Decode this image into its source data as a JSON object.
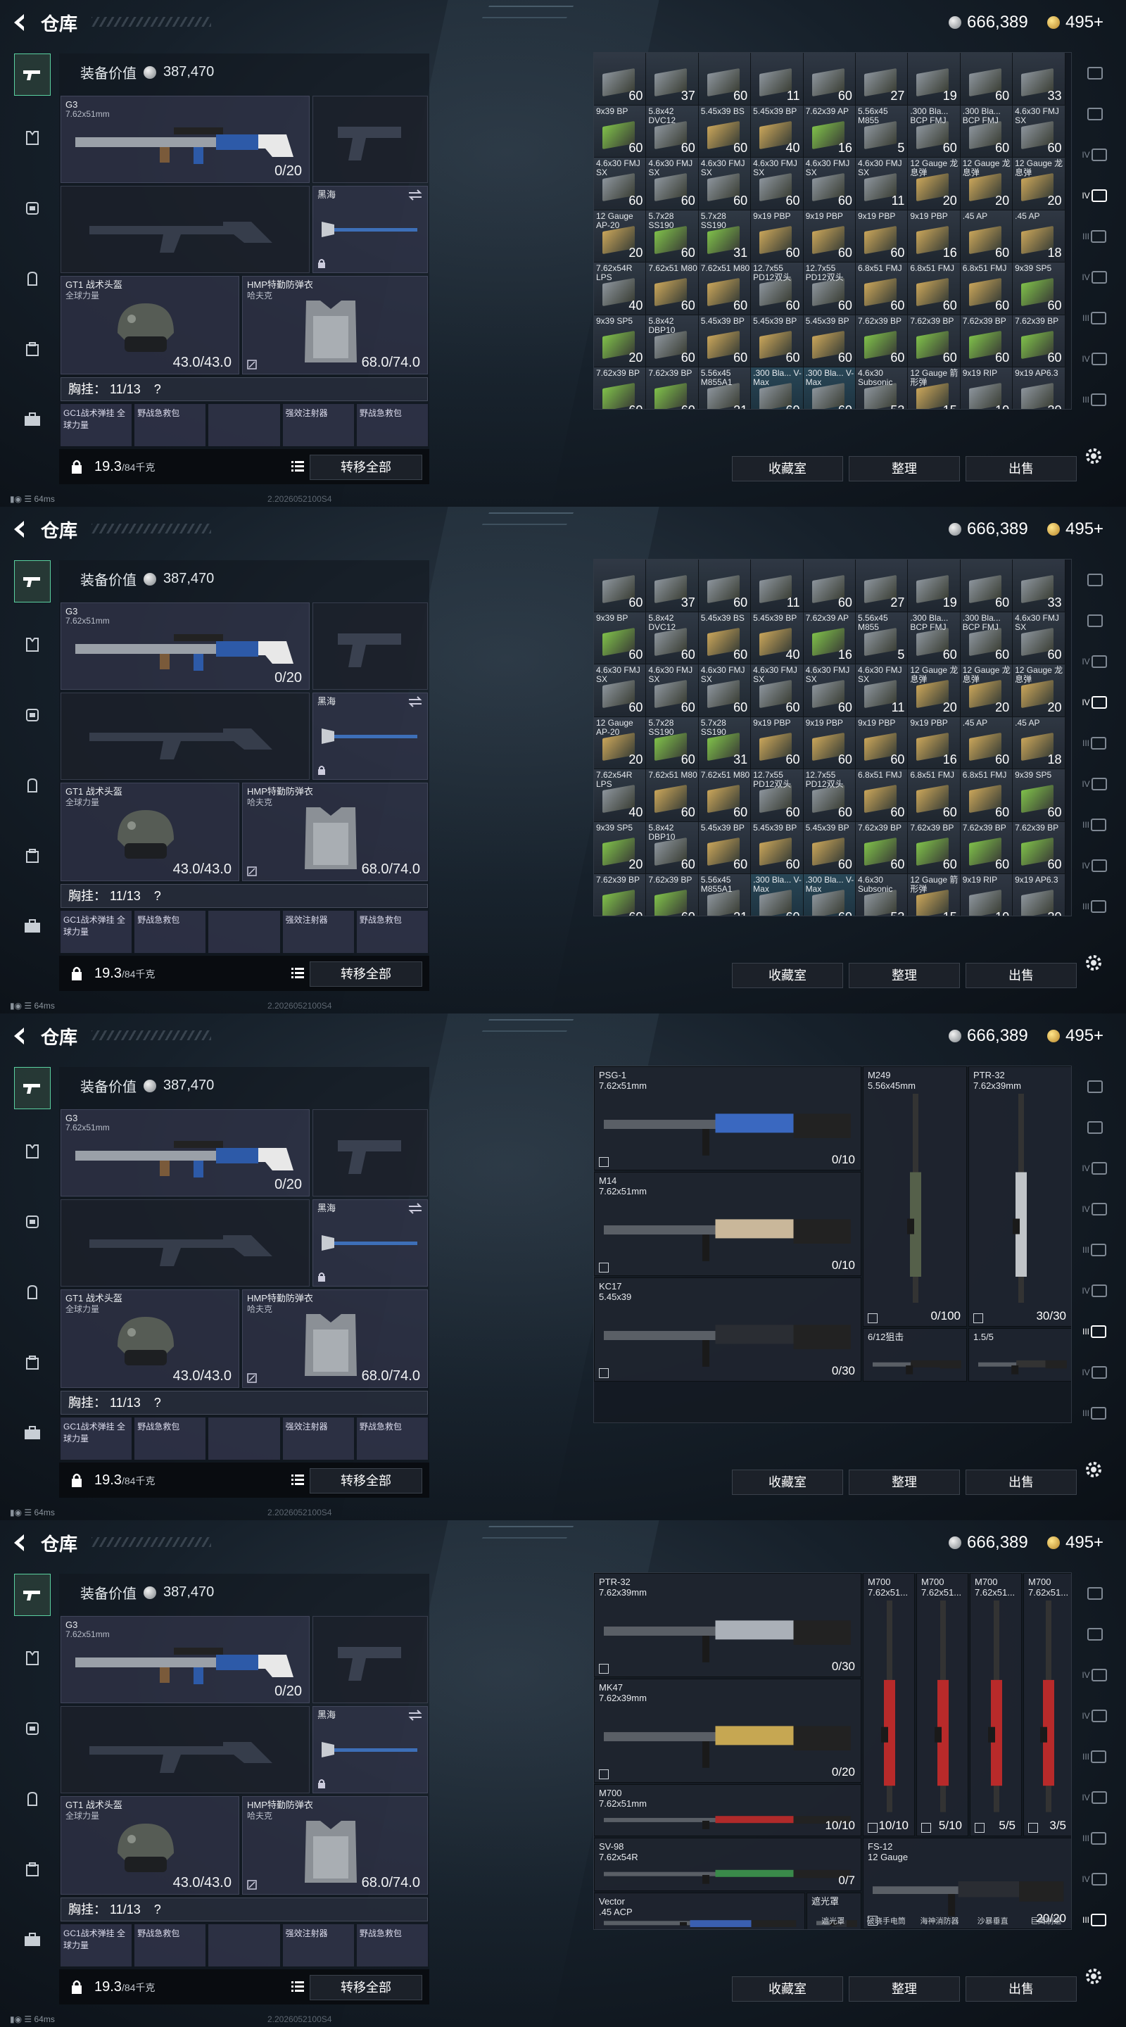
{
  "app": {
    "title": "仓库",
    "silver": "666,389",
    "gold": "495+",
    "ping": "64ms",
    "build": "2.2026052100S4"
  },
  "loadout": {
    "equip_value_label": "装备价值",
    "equip_value": "387,470",
    "primary": {
      "name": "G3",
      "caliber": "7.62x51mm",
      "ammo": "0/20"
    },
    "melee": {
      "name": "黑海"
    },
    "helmet": {
      "name": "GT1 战术头盔",
      "sub": "全球力量",
      "durability": "43.0/43.0"
    },
    "armor": {
      "name": "HMP特勤防弹衣",
      "sub": "哈夫克",
      "durability": "68.0/74.0"
    },
    "chest_label": "胸挂：",
    "chest_value": "11/13",
    "chest_help": "?",
    "pockets": [
      "GC1战术弹挂 全球力量",
      "野战急救包",
      "",
      "强效注射器",
      "野战急救包"
    ],
    "weight": "19.3",
    "weight_max": "/84千克",
    "transfer_label": "转移全部"
  },
  "actions": {
    "vault": "收藏室",
    "sort": "整理",
    "sell": "出售"
  },
  "rail": [
    "",
    "",
    "IV",
    "IV",
    "III",
    "IV",
    "III",
    "IV",
    "III"
  ],
  "ammo_rows": [
    [
      [
        "",
        "60"
      ],
      [
        "",
        "37"
      ],
      [
        "",
        "60"
      ],
      [
        "",
        "11"
      ],
      [
        "",
        "60"
      ],
      [
        "",
        "27"
      ],
      [
        "",
        "19"
      ],
      [
        "",
        "60"
      ],
      [
        "",
        "33"
      ]
    ],
    [
      [
        "9x39 BP",
        "60"
      ],
      [
        "5.8x42 DVC12",
        "60"
      ],
      [
        "5.45x39 BS",
        "60"
      ],
      [
        "5.45x39 BP",
        "40"
      ],
      [
        "7.62x39 AP",
        "16"
      ],
      [
        "5.56x45 M855",
        "5"
      ],
      [
        ".300 Bla... BCP FMJ",
        "60"
      ],
      [
        ".300 Bla... BCP FMJ",
        "60"
      ],
      [
        "4.6x30 FMJ SX",
        "60"
      ]
    ],
    [
      [
        "4.6x30 FMJ SX",
        "60"
      ],
      [
        "4.6x30 FMJ SX",
        "60"
      ],
      [
        "4.6x30 FMJ SX",
        "60"
      ],
      [
        "4.6x30 FMJ SX",
        "60"
      ],
      [
        "4.6x30 FMJ SX",
        "60"
      ],
      [
        "4.6x30 FMJ SX",
        "11"
      ],
      [
        "12 Gauge 龙息弹",
        "20"
      ],
      [
        "12 Gauge 龙息弹",
        "20"
      ],
      [
        "12 Gauge 龙息弹",
        "20"
      ]
    ],
    [
      [
        "12 Gauge AP-20",
        "20"
      ],
      [
        "5.7x28 SS190",
        "60"
      ],
      [
        "5.7x28 SS190",
        "31"
      ],
      [
        "9x19 PBP",
        "60"
      ],
      [
        "9x19 PBP",
        "60"
      ],
      [
        "9x19 PBP",
        "60"
      ],
      [
        "9x19 PBP",
        "16"
      ],
      [
        ".45 AP",
        "60"
      ],
      [
        ".45 AP",
        "18"
      ]
    ],
    [
      [
        "7.62x54R LPS",
        "40"
      ],
      [
        "7.62x51 M80",
        "60"
      ],
      [
        "7.62x51 M80",
        "60"
      ],
      [
        "12.7x55 PD12双头",
        "60"
      ],
      [
        "12.7x55 PD12双头",
        "60"
      ],
      [
        "6.8x51 FMJ",
        "60"
      ],
      [
        "6.8x51 FMJ",
        "60"
      ],
      [
        "6.8x51 FMJ",
        "60"
      ],
      [
        "9x39 SP5",
        "60"
      ]
    ],
    [
      [
        "9x39 SP5",
        "20"
      ],
      [
        "5.8x42 DBP10",
        "60"
      ],
      [
        "5.45x39 BP",
        "60"
      ],
      [
        "5.45x39 BP",
        "60"
      ],
      [
        "5.45x39 BP",
        "60"
      ],
      [
        "7.62x39 BP",
        "60"
      ],
      [
        "7.62x39 BP",
        "60"
      ],
      [
        "7.62x39 BP",
        "60"
      ],
      [
        "7.62x39 BP",
        "60"
      ]
    ],
    [
      [
        "7.62x39 BP",
        "60"
      ],
      [
        "7.62x39 BP",
        "60"
      ],
      [
        "5.56x45 M855A1",
        "21"
      ],
      [
        ".300 Bla... V-Max",
        "60"
      ],
      [
        ".300 Bla... V-Max",
        "60"
      ],
      [
        "4.6x30 Subsonic",
        "53"
      ],
      [
        "12 Gauge 箭形弹",
        "15"
      ],
      [
        "9x19 RIP",
        "10"
      ],
      [
        "9x19 AP6.3",
        "30"
      ]
    ]
  ],
  "weapons_a": {
    "items": [
      {
        "name": "PSG-1",
        "cal": "7.62x51mm",
        "val": "0/10"
      },
      {
        "name": "M14",
        "cal": "7.62x51mm",
        "val": "0/10"
      },
      {
        "name": "KC17",
        "cal": "5.45x39",
        "val": "0/30"
      },
      {
        "name": "M249",
        "cal": "5.56x45mm",
        "val": "0/100"
      },
      {
        "name": "PTR-32",
        "cal": "7.62x39mm",
        "val": "30/30"
      },
      {
        "name": "6/12狙击",
        "cal": "",
        "val": ""
      },
      {
        "name": "1.5/5",
        "cal": "",
        "val": ""
      }
    ]
  },
  "weapons_b": {
    "items": [
      {
        "name": "PTR-32",
        "cal": "7.62x39mm",
        "val": "0/30"
      },
      {
        "name": "MK47",
        "cal": "7.62x39mm",
        "val": "0/20"
      },
      {
        "name": "M700",
        "cal": "7.62x51mm",
        "val": "10/10"
      },
      {
        "name": "SV-98",
        "cal": "7.62x54R",
        "val": "0/7"
      },
      {
        "name": "Vector",
        "cal": ".45 ACP",
        "val": ""
      },
      {
        "name": "M700",
        "cal": "7.62x51...",
        "val": "10/10"
      },
      {
        "name": "M700",
        "cal": "7.62x51...",
        "val": "5/10"
      },
      {
        "name": "M700",
        "cal": "7.62x51...",
        "val": "5/5"
      },
      {
        "name": "M700",
        "cal": "7.62x51...",
        "val": "3/5"
      },
      {
        "name": "FS-12",
        "cal": "12 Gauge",
        "val": "20/20"
      },
      {
        "name": "遮光罩",
        "cal": "",
        "val": ""
      }
    ],
    "attachments": [
      "遮光罩",
      "破晓手电筒",
      "海神消防器",
      "沙暴垂直",
      "巨鹰制退"
    ]
  },
  "colors": {
    "accent_green": "#5ad1a0",
    "ammo_green": "#7fc04a",
    "ammo_tan": "#c9a55a",
    "ammo_gray": "#8c949c"
  }
}
